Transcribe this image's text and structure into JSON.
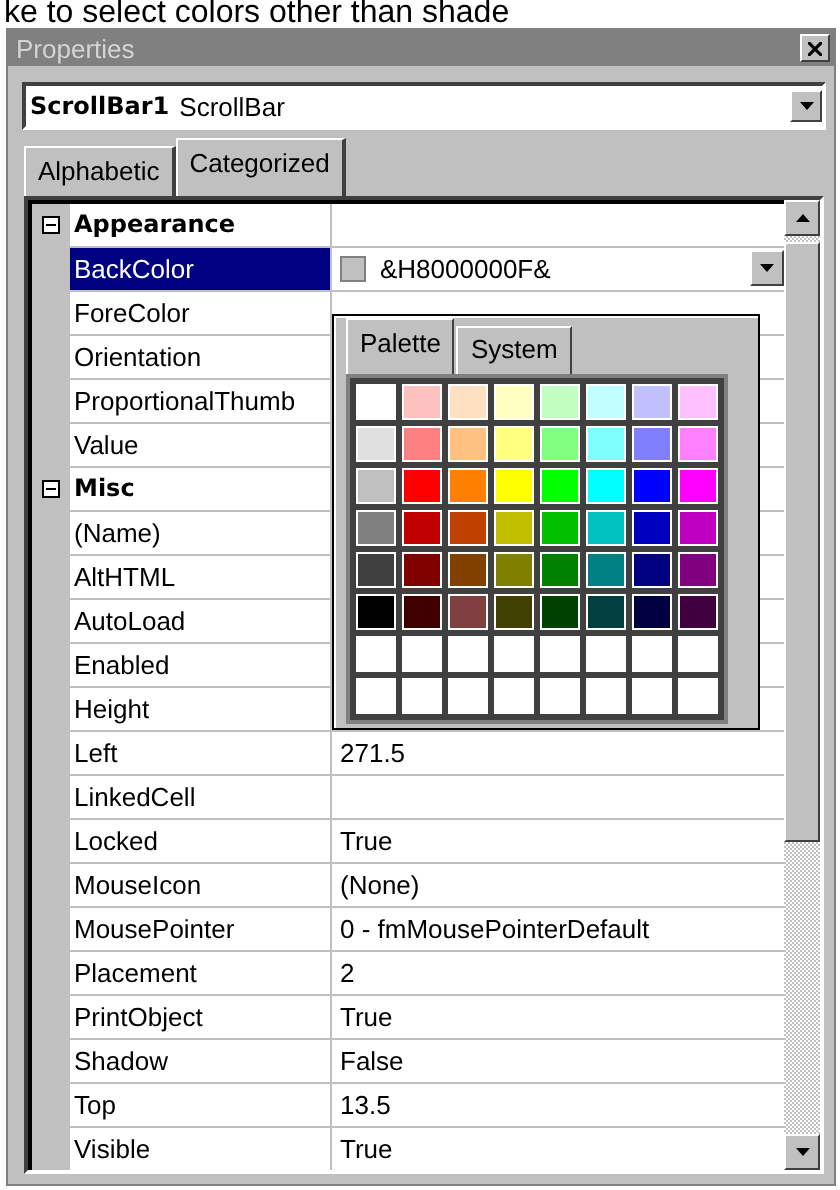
{
  "caption": "ke to select colors other than shade",
  "window": {
    "title": "Properties"
  },
  "object_selector": {
    "name": "ScrollBar1",
    "type": "ScrollBar"
  },
  "tabs": [
    {
      "label": "Alphabetic",
      "selected": false
    },
    {
      "label": "Categorized",
      "selected": true
    }
  ],
  "categories": [
    {
      "label": "Appearance",
      "expanded": true,
      "properties": [
        {
          "name": "BackColor",
          "value": "&H8000000F&",
          "color": "#c0c0c0",
          "selected": true
        },
        {
          "name": "ForeColor",
          "selected": false
        },
        {
          "name": "Orientation",
          "selected": false
        },
        {
          "name": "ProportionalThumb",
          "selected": false
        },
        {
          "name": "Value",
          "selected": false
        }
      ]
    },
    {
      "label": "Misc",
      "expanded": true,
      "properties": [
        {
          "name": "(Name)",
          "selected": false
        },
        {
          "name": "AltHTML",
          "selected": false
        },
        {
          "name": "AutoLoad",
          "selected": false
        },
        {
          "name": "Enabled",
          "selected": false
        },
        {
          "name": "Height",
          "selected": false
        },
        {
          "name": "Left",
          "value": "271.5",
          "selected": false
        },
        {
          "name": "LinkedCell",
          "selected": false
        },
        {
          "name": "Locked",
          "value": "True",
          "selected": false
        },
        {
          "name": "MouseIcon",
          "value": "(None)",
          "selected": false
        },
        {
          "name": "MousePointer",
          "value": "0 - fmMousePointerDefault",
          "selected": false
        },
        {
          "name": "Placement",
          "value": "2",
          "selected": false
        },
        {
          "name": "PrintObject",
          "value": "True",
          "selected": false
        },
        {
          "name": "Shadow",
          "value": "False",
          "selected": false
        },
        {
          "name": "Top",
          "value": "13.5",
          "selected": false
        },
        {
          "name": "Visible",
          "value": "True",
          "selected": false
        }
      ]
    }
  ],
  "color_popup": {
    "tabs": [
      {
        "label": "Palette",
        "selected": true
      },
      {
        "label": "System",
        "selected": false
      }
    ],
    "swatch_rows": [
      {
        "swatches": [
          {
            "color": "#ffffff"
          },
          {
            "color": "#ffc0c0"
          },
          {
            "color": "#ffe0c0"
          },
          {
            "color": "#ffffc0"
          },
          {
            "color": "#c0ffc0"
          },
          {
            "color": "#c0ffff"
          },
          {
            "color": "#c0c0ff"
          },
          {
            "color": "#ffc0ff"
          }
        ]
      },
      {
        "swatches": [
          {
            "color": "#e0e0e0"
          },
          {
            "color": "#ff8080"
          },
          {
            "color": "#ffc080"
          },
          {
            "color": "#ffff80"
          },
          {
            "color": "#80ff80"
          },
          {
            "color": "#80ffff"
          },
          {
            "color": "#8080ff"
          },
          {
            "color": "#ff80ff"
          }
        ]
      },
      {
        "swatches": [
          {
            "color": "#c0c0c0"
          },
          {
            "color": "#ff0000"
          },
          {
            "color": "#ff8000"
          },
          {
            "color": "#ffff00"
          },
          {
            "color": "#00ff00"
          },
          {
            "color": "#00ffff"
          },
          {
            "color": "#0000ff"
          },
          {
            "color": "#ff00ff"
          }
        ]
      },
      {
        "swatches": [
          {
            "color": "#808080"
          },
          {
            "color": "#c00000"
          },
          {
            "color": "#c04000"
          },
          {
            "color": "#c0c000"
          },
          {
            "color": "#00c000"
          },
          {
            "color": "#00c0c0"
          },
          {
            "color": "#0000c0"
          },
          {
            "color": "#c000c0"
          }
        ]
      },
      {
        "swatches": [
          {
            "color": "#404040"
          },
          {
            "color": "#800000"
          },
          {
            "color": "#804000"
          },
          {
            "color": "#808000"
          },
          {
            "color": "#008000"
          },
          {
            "color": "#008080"
          },
          {
            "color": "#000080"
          },
          {
            "color": "#800080"
          }
        ]
      },
      {
        "swatches": [
          {
            "color": "#000000"
          },
          {
            "color": "#400000"
          },
          {
            "color": "#804040"
          },
          {
            "color": "#404000"
          },
          {
            "color": "#004000"
          },
          {
            "color": "#004040"
          },
          {
            "color": "#000040"
          },
          {
            "color": "#400040"
          }
        ]
      },
      {
        "swatches": [
          {
            "color": "#ffffff"
          },
          {
            "color": "#ffffff"
          },
          {
            "color": "#ffffff"
          },
          {
            "color": "#ffffff"
          },
          {
            "color": "#ffffff"
          },
          {
            "color": "#ffffff"
          },
          {
            "color": "#ffffff"
          },
          {
            "color": "#ffffff"
          }
        ]
      },
      {
        "swatches": [
          {
            "color": "#ffffff"
          },
          {
            "color": "#ffffff"
          },
          {
            "color": "#ffffff"
          },
          {
            "color": "#ffffff"
          },
          {
            "color": "#ffffff"
          },
          {
            "color": "#ffffff"
          },
          {
            "color": "#ffffff"
          },
          {
            "color": "#ffffff"
          }
        ]
      }
    ]
  }
}
